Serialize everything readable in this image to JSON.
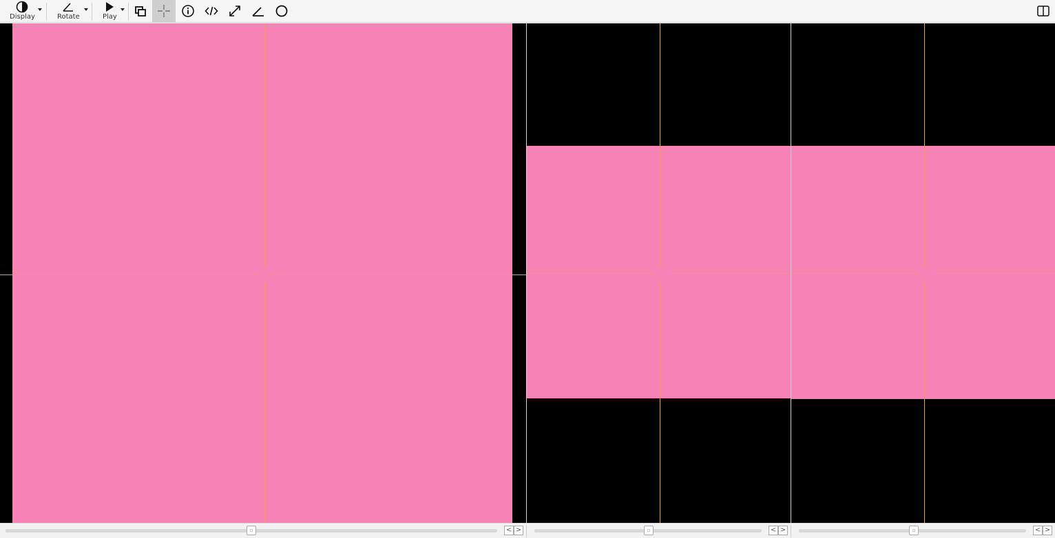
{
  "toolbar": {
    "display_label": "Display",
    "rotate_label": "Rotate",
    "play_label": "Play",
    "icons": {
      "display": "contrast-icon",
      "rotate": "angle-icon",
      "play": "play-icon",
      "layers": "layers-icon",
      "crosshair": "crosshair-icon",
      "info": "info-icon",
      "code": "code-icon",
      "expand": "expand-icon",
      "angle": "angle-measure-icon",
      "circle": "circle-icon",
      "split_view": "split-view-icon"
    }
  },
  "bottom_bar": {
    "prev_glyph": "<",
    "next_glyph": ">"
  },
  "colors": {
    "image_fill": "#f783b6",
    "crosshair": "#f2a23a",
    "background": "#000000"
  }
}
